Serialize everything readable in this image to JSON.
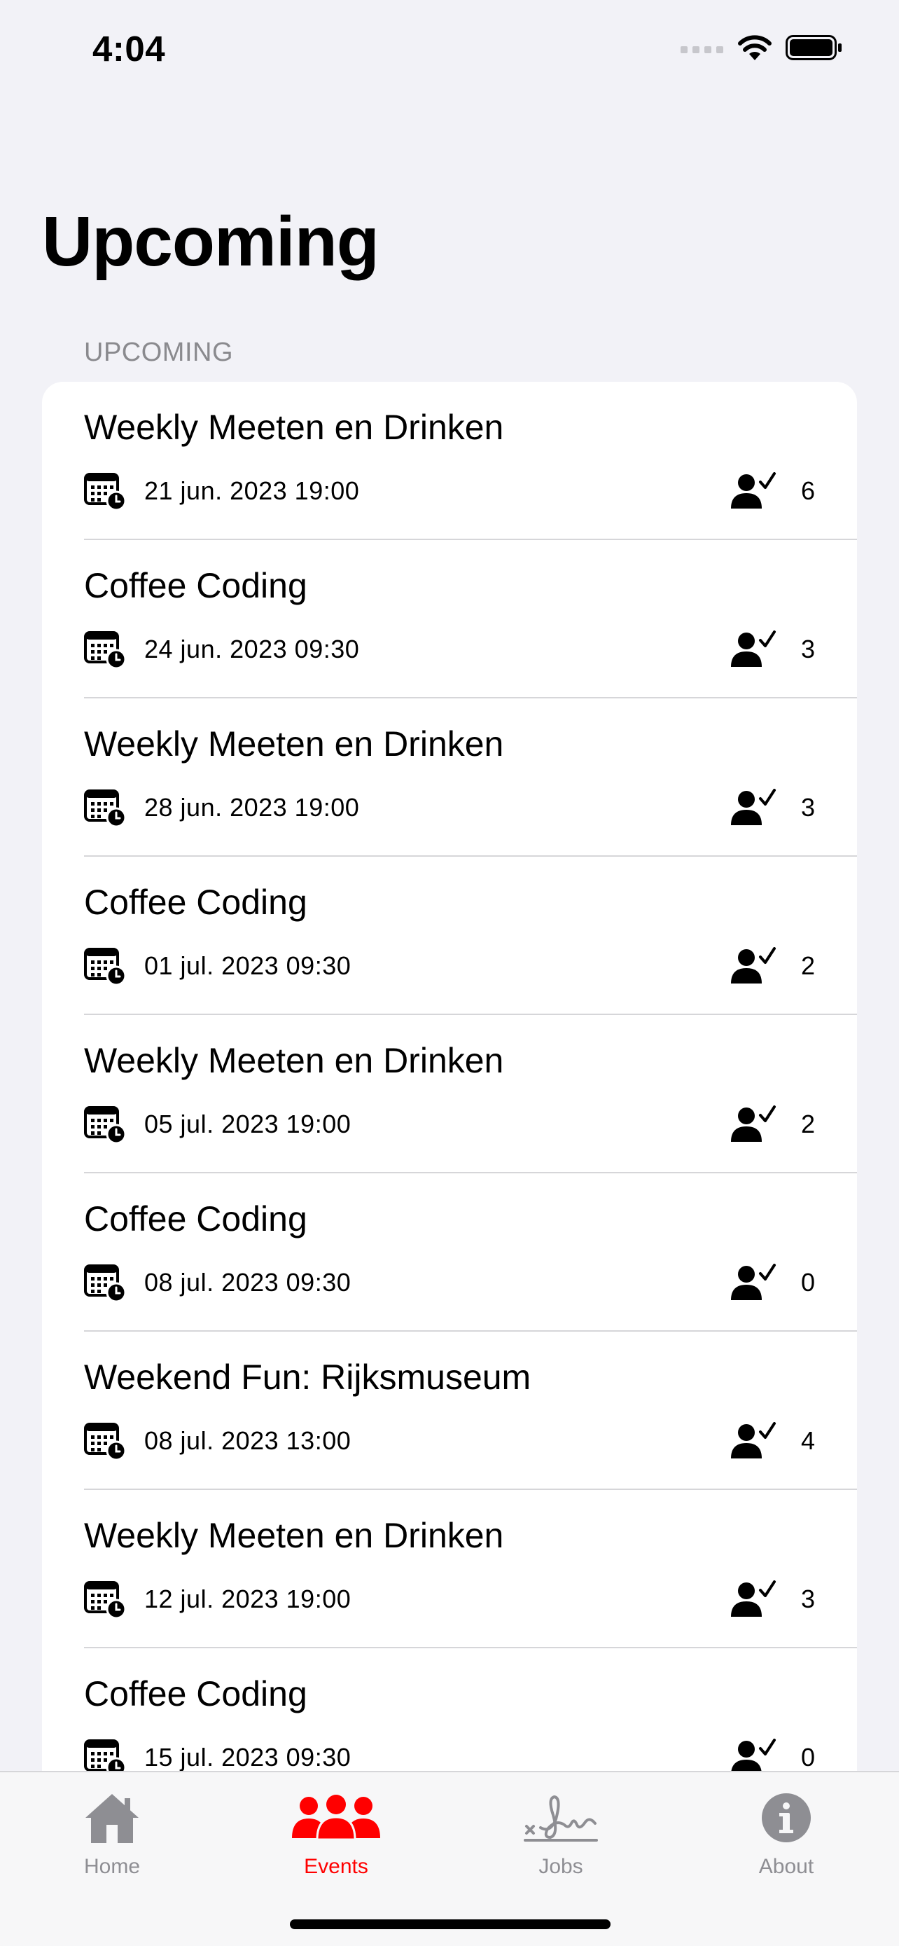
{
  "status_bar": {
    "time": "4:04"
  },
  "page": {
    "title": "Upcoming",
    "section_header": "UPCOMING"
  },
  "events": [
    {
      "title": "Weekly Meeten en Drinken",
      "date": "21 jun. 2023 19:00",
      "attendees": "6"
    },
    {
      "title": "Coffee Coding",
      "date": "24 jun. 2023 09:30",
      "attendees": "3"
    },
    {
      "title": "Weekly Meeten en Drinken",
      "date": "28 jun. 2023 19:00",
      "attendees": "3"
    },
    {
      "title": "Coffee Coding",
      "date": "01 jul. 2023 09:30",
      "attendees": "2"
    },
    {
      "title": "Weekly Meeten en Drinken",
      "date": "05 jul. 2023 19:00",
      "attendees": "2"
    },
    {
      "title": "Coffee Coding",
      "date": "08 jul. 2023 09:30",
      "attendees": "0"
    },
    {
      "title": "Weekend Fun: Rijksmuseum",
      "date": "08 jul. 2023 13:00",
      "attendees": "4"
    },
    {
      "title": "Weekly Meeten en Drinken",
      "date": "12 jul. 2023 19:00",
      "attendees": "3"
    },
    {
      "title": "Coffee Coding",
      "date": "15 jul. 2023 09:30",
      "attendees": "0"
    }
  ],
  "tab_bar": {
    "tabs": [
      {
        "label": "Home",
        "icon": "house-icon",
        "active": false
      },
      {
        "label": "Events",
        "icon": "people-icon",
        "active": true
      },
      {
        "label": "Jobs",
        "icon": "signature-icon",
        "active": false
      },
      {
        "label": "About",
        "icon": "info-icon",
        "active": false
      }
    ]
  },
  "colors": {
    "accent": "#ff0000",
    "inactive": "#8e8e93",
    "background": "#f2f2f7"
  }
}
